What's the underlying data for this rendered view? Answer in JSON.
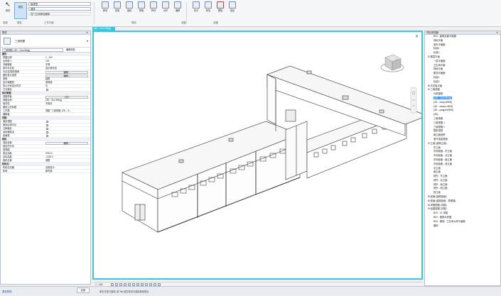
{
  "ribbon": {
    "modify_label": "修改",
    "properties_label": "属性",
    "type_dropdown": "族类型",
    "type_value": "墙体",
    "option_text": "在门之间添加墙体",
    "workplane_label": "工作平面",
    "buttons": [
      "移动",
      "复制",
      "旋转",
      "镜像",
      "阵列",
      "对齐",
      "偏移",
      "拆分",
      "修剪",
      "删除",
      "锁定",
      "标记",
      "测量",
      "视图"
    ],
    "group_labels": [
      "选择",
      "属性",
      "修改",
      "测量",
      "创建"
    ]
  },
  "properties": {
    "title": "属性",
    "type_name": "三维视图",
    "instance_dropdown": "三维视图: {3D - Guo Ming}",
    "edit_type": "编辑类型",
    "rows": [
      {
        "section": true,
        "key": "图形"
      },
      {
        "key": "视图比例",
        "value": "1 : 100"
      },
      {
        "key": "比例值 1:",
        "value": "100"
      },
      {
        "key": "详细程度",
        "value": "中等"
      },
      {
        "key": "零件可见性",
        "value": "显示原状态"
      },
      {
        "key": "可见性/图形替换",
        "button": "编辑..."
      },
      {
        "key": "图形显示选项",
        "button": "编辑..."
      },
      {
        "key": "规程",
        "value": "建筑"
      },
      {
        "key": "显示隐藏线",
        "value": "按规程"
      },
      {
        "key": "默认分析显示样式",
        "value": "无"
      },
      {
        "key": "日光路径",
        "check": true
      },
      {
        "section": true,
        "key": "标识数据"
      },
      {
        "key": "视图样板",
        "button": "<无>"
      },
      {
        "key": "视图名称",
        "value": "{3D - Guo Ming}"
      },
      {
        "key": "相关性",
        "value": "不相关"
      },
      {
        "key": "图纸上的标题",
        "value": ""
      },
      {
        "key": "工作集",
        "value": "视图 \"三维视图: {3D - G..."
      },
      {
        "key": "编辑者",
        "value": ""
      },
      {
        "section": true,
        "key": "范围"
      },
      {
        "key": "裁剪视图",
        "check": true
      },
      {
        "key": "裁剪区域可见",
        "check": true
      },
      {
        "key": "注释裁剪",
        "check": true
      },
      {
        "key": "远剪裁激活",
        "check": true
      },
      {
        "key": "剖面框",
        "check": true
      },
      {
        "section": true,
        "key": "相机"
      },
      {
        "key": "渲染设置",
        "button": "编辑..."
      },
      {
        "key": "锁定的方向",
        "value": ""
      },
      {
        "key": "透视图",
        "value": ""
      },
      {
        "key": "视点高度",
        "value": "9763.0"
      },
      {
        "key": "目标高度",
        "value": "-2433.4"
      },
      {
        "key": "相机位置",
        "value": "调整"
      },
      {
        "section": true,
        "key": "阶段化"
      },
      {
        "key": "阶段过滤器",
        "value": "全部显示"
      },
      {
        "key": "阶段",
        "value": "新构造"
      }
    ],
    "help_link": "属性帮助",
    "apply_button": "应用"
  },
  "view": {
    "tab_label": "{3D - Guo Ming}",
    "scale_text": "1 : 100"
  },
  "browser": {
    "title": "项目浏览器",
    "items": [
      {
        "indent": 3,
        "text": "B03 - 建筑走廊平面图"
      },
      {
        "indent": 3,
        "text": "场地平面"
      },
      {
        "indent": 3,
        "text": "室外平面图"
      },
      {
        "indent": 3,
        "text": "标高1"
      },
      {
        "indent": 3,
        "text": "标高2"
      },
      {
        "indent": 1,
        "text": "⊟ 楼层平面"
      },
      {
        "indent": 3,
        "text": "一层平面图"
      },
      {
        "indent": 3,
        "text": "卫生间平面"
      },
      {
        "indent": 3,
        "text": "场地平面"
      },
      {
        "indent": 3,
        "text": "屋顶平面图"
      },
      {
        "indent": 3,
        "text": "标高1"
      },
      {
        "indent": 3,
        "text": "标高2"
      },
      {
        "indent": 1,
        "text": "⊞ 天花板平面"
      },
      {
        "indent": 1,
        "text": "⊟ 三维视图"
      },
      {
        "indent": 3,
        "text": "分析模型"
      },
      {
        "indent": 3,
        "text": "{3D - Guo Ming}",
        "selected": true
      },
      {
        "indent": 3,
        "text": "{3D - xiaoyu0505}"
      },
      {
        "indent": 3,
        "text": "{3D - xiaoyu 0505}"
      },
      {
        "indent": 3,
        "text": "{3D - yangzhi0505}"
      },
      {
        "indent": 3,
        "text": "{3D}"
      },
      {
        "indent": 3,
        "text": "三维视图"
      },
      {
        "indent": 3,
        "text": "三维视图 1"
      },
      {
        "indent": 3,
        "text": "三维视图 2"
      },
      {
        "indent": 3,
        "text": "整层透视"
      },
      {
        "indent": 3,
        "text": "南立面透视"
      },
      {
        "indent": 3,
        "text": "室外渲染视图"
      },
      {
        "indent": 1,
        "text": "⊟ 立面 (建筑立面)"
      },
      {
        "indent": 3,
        "text": "东立面"
      },
      {
        "indent": 3,
        "text": "东侧剖面 - 东立面"
      },
      {
        "indent": 3,
        "text": "东侧剖面 - 北立面"
      },
      {
        "indent": 3,
        "text": "东侧剖面 - 南立面"
      },
      {
        "indent": 3,
        "text": "东侧剖面 - 西立面"
      },
      {
        "indent": 3,
        "text": "北立面"
      },
      {
        "indent": 3,
        "text": "南立面"
      },
      {
        "indent": 3,
        "text": "场外 - 东立面"
      },
      {
        "indent": 3,
        "text": "场外 - 北立面"
      },
      {
        "indent": 3,
        "text": "场外 - 南立面"
      },
      {
        "indent": 3,
        "text": "场外 - 西立面"
      },
      {
        "indent": 3,
        "text": "西立面"
      },
      {
        "indent": 1,
        "text": "⊞ 剖面 (建筑剖面)"
      },
      {
        "indent": 1,
        "text": "⊞ 剖面 (建筑剖面 - 带楼梯)"
      },
      {
        "indent": 1,
        "text": "⊞ 详图视图 (详图)"
      },
      {
        "indent": 1,
        "text": "⊟ 绘图视图 (详图)"
      },
      {
        "indent": 3,
        "text": "B03 - 01 详图"
      },
      {
        "indent": 3,
        "text": "B03 - 楼梯大样图"
      },
      {
        "indent": 3,
        "text": "B03 - 楼梯 - 卫生间大样平面图"
      },
      {
        "indent": 3,
        "text": "图例"
      }
    ]
  },
  "status": {
    "left_text": "单击可进行选择; 按 Tab 键并单击可选择其他项目"
  },
  "colors": {
    "accent": "#38c5e0",
    "selection": "#3399ff",
    "panel_header": "#e4e8ee"
  }
}
